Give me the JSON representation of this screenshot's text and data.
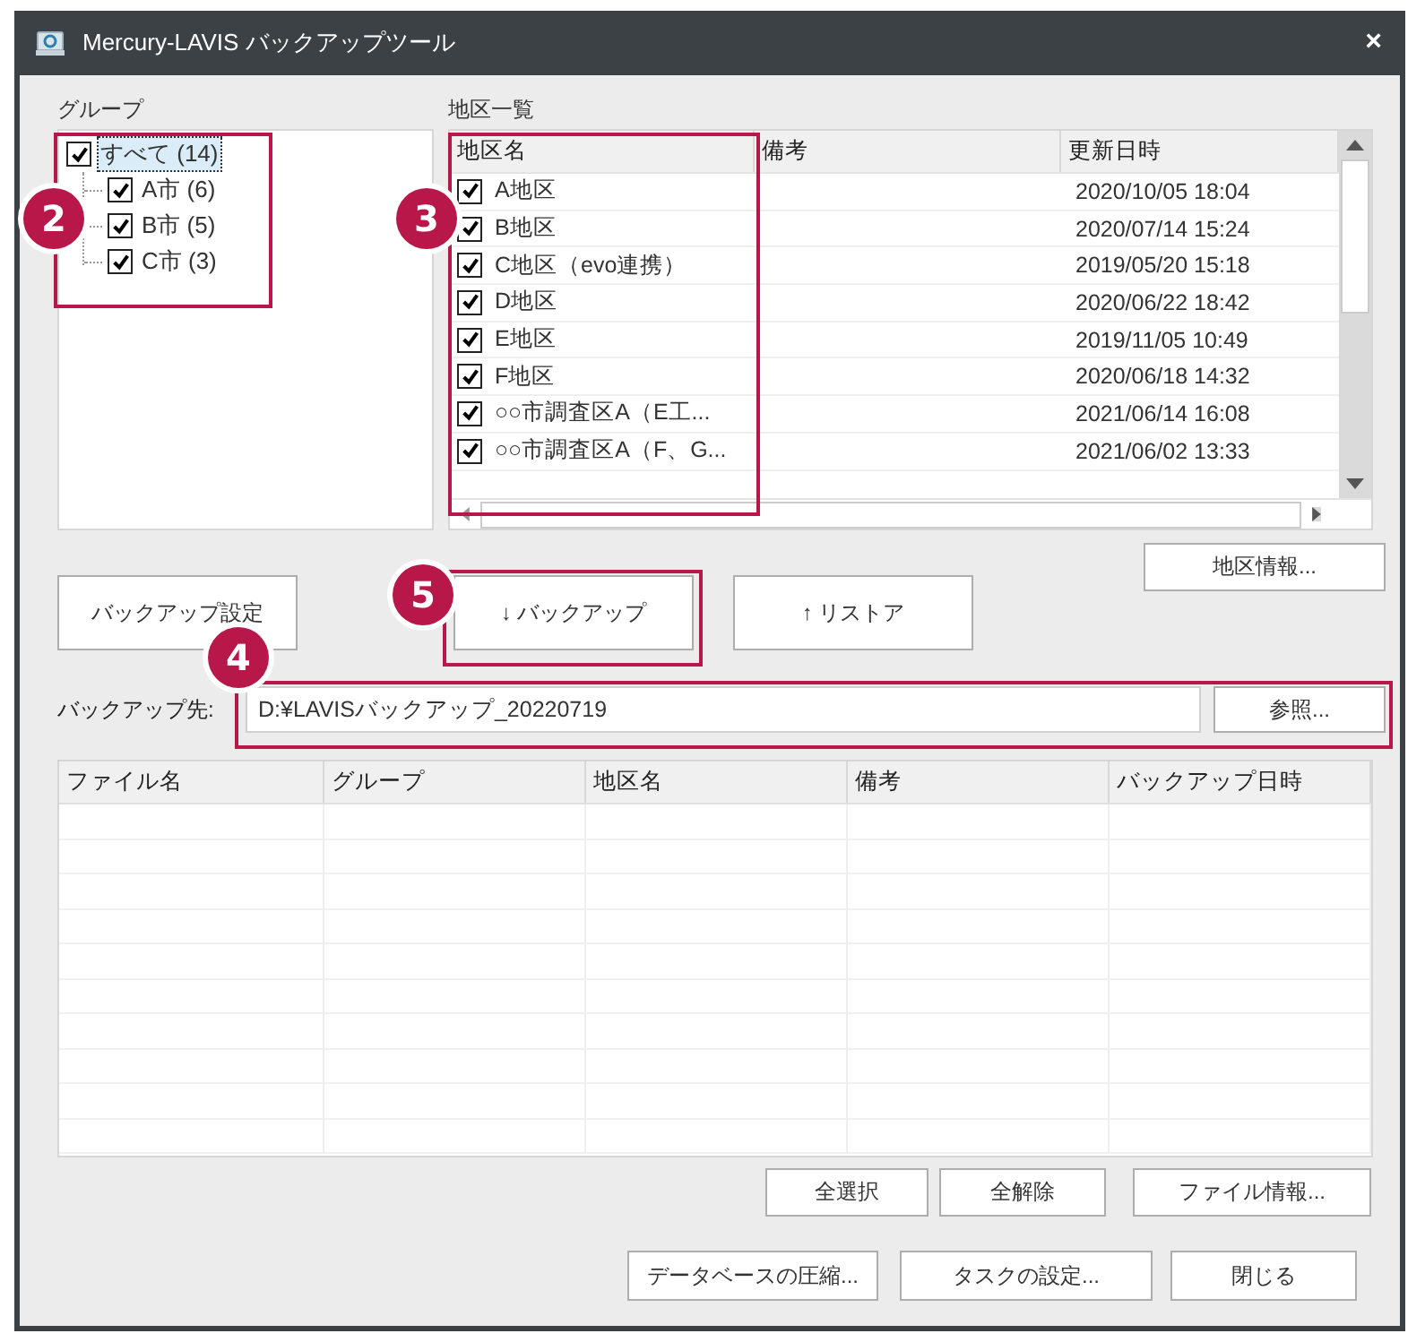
{
  "window": {
    "title": "Mercury-LAVIS バックアップツール",
    "close": "×"
  },
  "group_panel": {
    "label": "グループ",
    "tree": [
      {
        "label": "すべて (14)",
        "checked": true,
        "selected": true,
        "children": [
          {
            "label": "A市 (6)",
            "checked": true,
            "selected": false
          },
          {
            "label": "B市 (5)",
            "checked": true,
            "selected": false
          },
          {
            "label": "C市 (3)",
            "checked": true,
            "selected": false
          }
        ]
      }
    ]
  },
  "district_list": {
    "label": "地区一覧",
    "columns": [
      "地区名",
      "備考",
      "更新日時"
    ],
    "rows": [
      {
        "name": "A地区",
        "checked": true,
        "updated": "2020/10/05 18:04"
      },
      {
        "name": "B地区",
        "checked": true,
        "updated": "2020/07/14 15:24"
      },
      {
        "name": "C地区（evo連携）",
        "checked": true,
        "updated": "2019/05/20 15:18"
      },
      {
        "name": "D地区",
        "checked": true,
        "updated": "2020/06/22 18:42"
      },
      {
        "name": "E地区",
        "checked": true,
        "updated": "2019/11/05 10:49"
      },
      {
        "name": "F地区",
        "checked": true,
        "updated": "2020/06/18 14:32"
      },
      {
        "name": "○○市調査区A（E工...",
        "checked": true,
        "updated": "2021/06/14 16:08"
      },
      {
        "name": "○○市調査区A（F、G...",
        "checked": true,
        "updated": "2021/06/02 13:33"
      }
    ]
  },
  "district_info_button": "地区情報...",
  "action_buttons": [
    {
      "kind": "settings",
      "label": "バックアップ設定"
    },
    {
      "kind": "backup",
      "label": "↓ バックアップ"
    },
    {
      "kind": "restore",
      "label": "↑ リストア"
    }
  ],
  "destination": {
    "label": "バックアップ先:",
    "value": "D:¥LAVISバックアップ_20220719",
    "browse": "参照..."
  },
  "file_table": {
    "columns": [
      "ファイル名",
      "グループ",
      "地区名",
      "備考",
      "バックアップ日時"
    ]
  },
  "selection_buttons": [
    "全選択",
    "全解除",
    "ファイル情報..."
  ],
  "footer_buttons": [
    "データベースの圧縮...",
    "タスクの設定...",
    "閉じる"
  ],
  "annotations": [
    {
      "number": "2"
    },
    {
      "number": "3"
    },
    {
      "number": "5"
    },
    {
      "number": "4"
    }
  ]
}
